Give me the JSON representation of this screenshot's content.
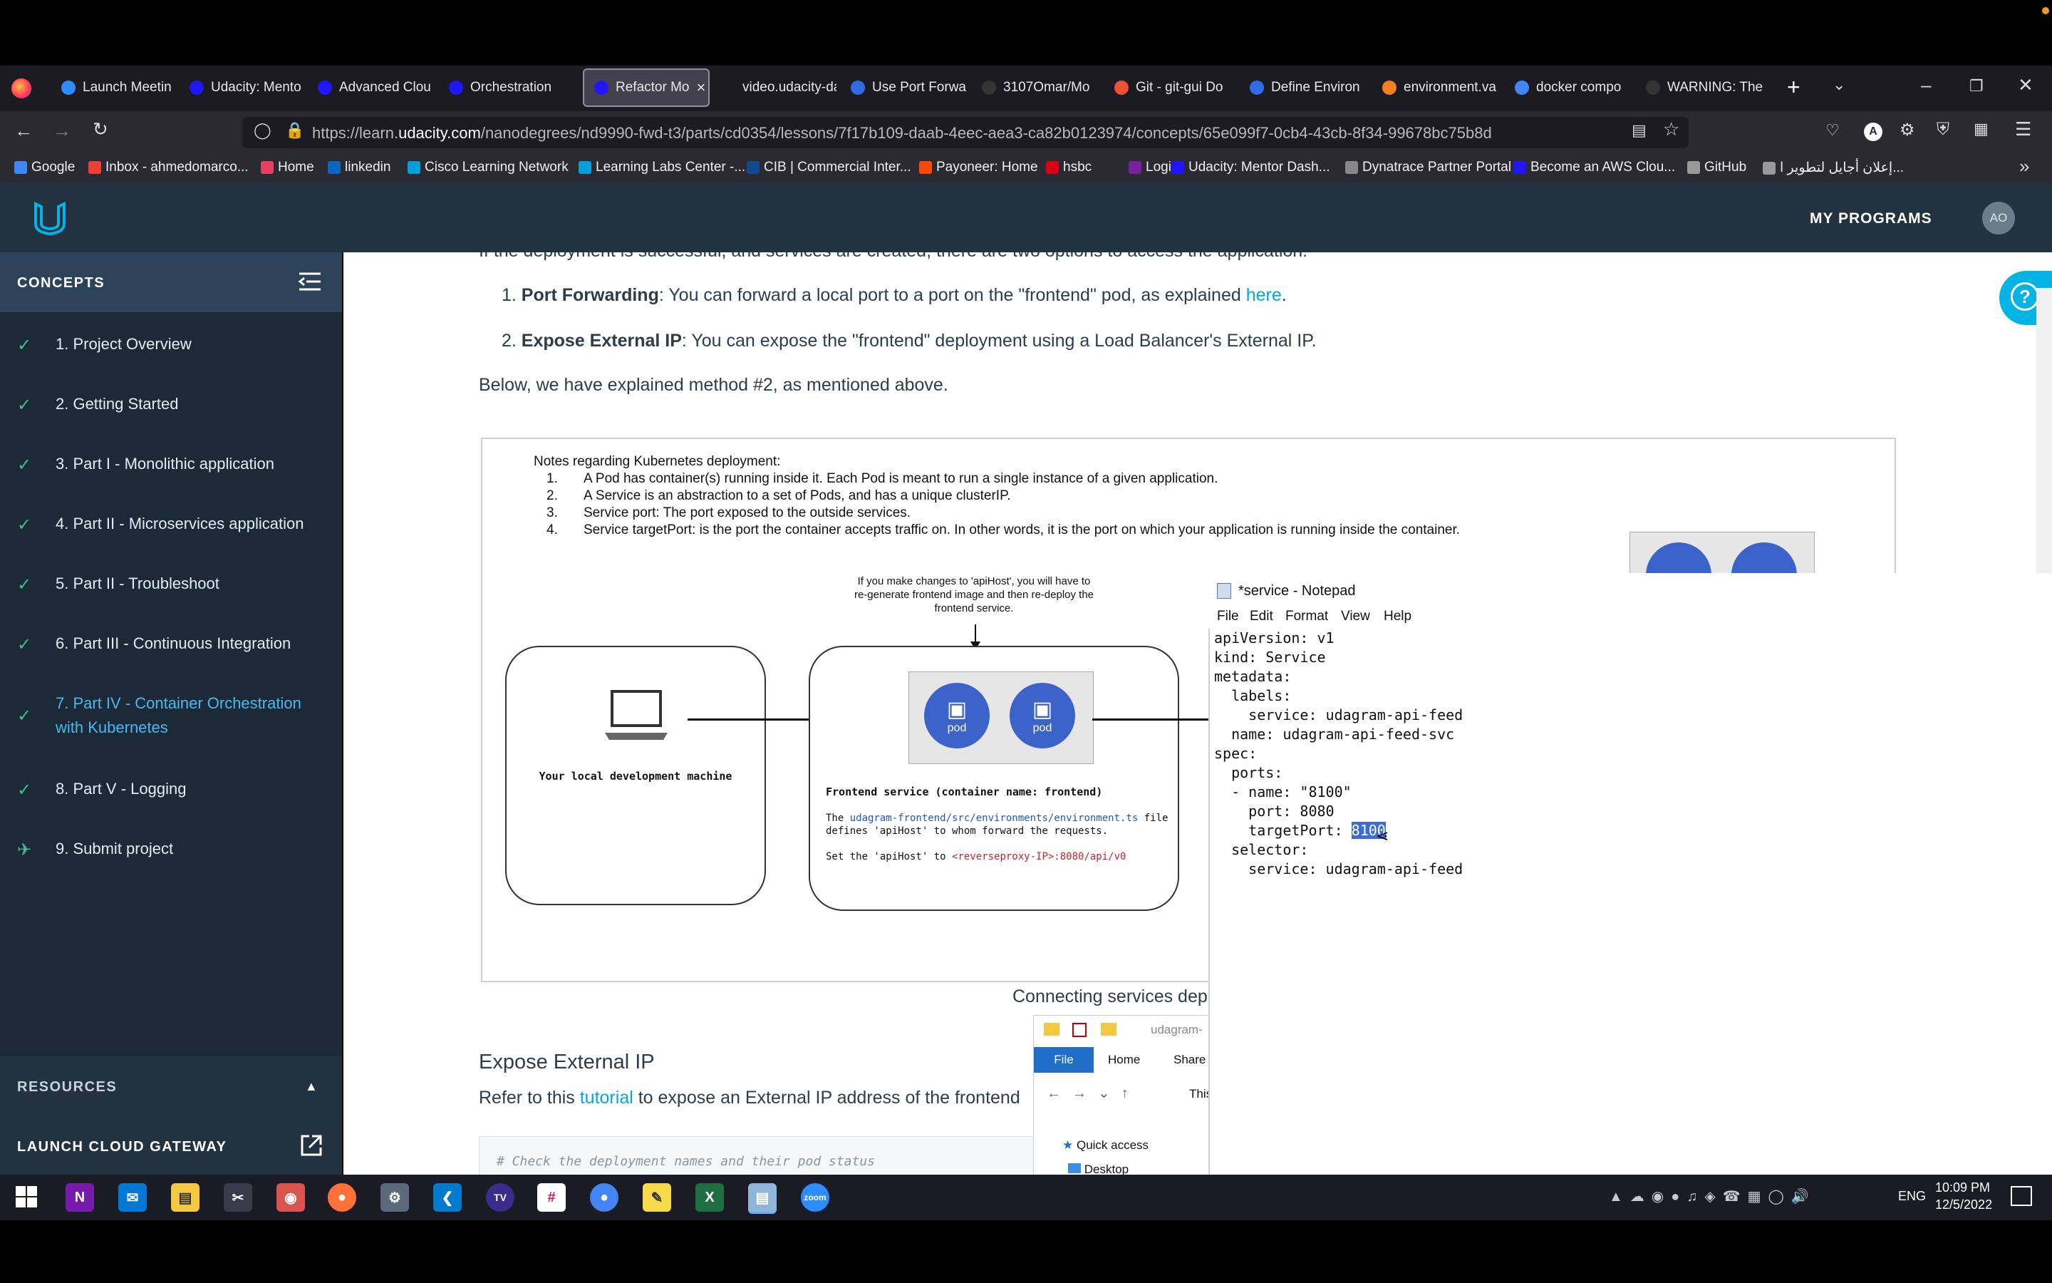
{
  "browser": {
    "tabs": [
      {
        "label": "Launch Meetin",
        "color": "#2d8cff"
      },
      {
        "label": "Udacity: Mento",
        "color": "#2015ff"
      },
      {
        "label": "Advanced Clou",
        "color": "#2015ff"
      },
      {
        "label": "Orchestration",
        "color": "#2015ff"
      },
      {
        "label": "Refactor Mo",
        "color": "#2015ff"
      },
      {
        "label": "video.udacity-data",
        "color": "#1c1b22"
      },
      {
        "label": "Use Port Forwa",
        "color": "#326ce5"
      },
      {
        "label": "3107Omar/Mo",
        "color": "#333333"
      },
      {
        "label": "Git - git-gui Do",
        "color": "#f05133"
      },
      {
        "label": "Define Environ",
        "color": "#326ce5"
      },
      {
        "label": "environment.va",
        "color": "#f48024"
      },
      {
        "label": "docker compo",
        "color": "#4285f4"
      },
      {
        "label": "WARNING: The",
        "color": "#333333"
      }
    ],
    "tab_close": "×",
    "new_tab": "+",
    "url_prefix": "https://learn.",
    "url_domain": "udacity.com",
    "url_rest": "/nanodegrees/nd9990-fwd-t3/parts/cd0354/lessons/7f17b109-daab-4eec-aea3-ca82b0123974/concepts/65e099f7-0cb4-43cb-8f34-99678bc75b8d",
    "bookmarks": [
      {
        "label": "Google",
        "color": "#4285f4"
      },
      {
        "label": "Inbox - ahmedomarco...",
        "color": "#ea4335"
      },
      {
        "label": "Home",
        "color": "#e4405f"
      },
      {
        "label": "linkedin",
        "color": "#0a66c2"
      },
      {
        "label": "Cisco Learning Network",
        "color": "#049fd9"
      },
      {
        "label": "Learning Labs Center -...",
        "color": "#049fd9"
      },
      {
        "label": "CIB | Commercial Inter...",
        "color": "#0d4a8f"
      },
      {
        "label": "Payoneer: Home",
        "color": "#ff4800"
      },
      {
        "label": "hsbc",
        "color": "#db0011"
      },
      {
        "label": "Login",
        "color": "#7a1fa2"
      },
      {
        "label": "Udacity: Mentor Dash...",
        "color": "#2015ff"
      },
      {
        "label": "Dynatrace Partner Portal",
        "color": "#888888"
      },
      {
        "label": "Become an AWS Clou...",
        "color": "#2015ff"
      },
      {
        "label": "GitHub",
        "color": "#999999"
      },
      {
        "label": "إعلان أجايل لتطوير ا...",
        "color": "#999999"
      }
    ]
  },
  "udacity": {
    "my_programs": "MY PROGRAMS",
    "avatar": "AO",
    "concepts_title": "CONCEPTS",
    "concepts": [
      {
        "label": "1. Project Overview"
      },
      {
        "label": "2. Getting Started"
      },
      {
        "label": "3. Part I - Monolithic application"
      },
      {
        "label": "4. Part II - Microservices application"
      },
      {
        "label": "5. Part II - Troubleshoot"
      },
      {
        "label": "6. Part III - Continuous Integration"
      },
      {
        "label": "7. Part IV - Container Orchestration",
        "label2": "with Kubernetes"
      },
      {
        "label": "8. Part V - Logging"
      },
      {
        "label": "9. Submit project"
      }
    ],
    "resources": "RESOURCES",
    "launch_gateway": "LAUNCH CLOUD GATEWAY"
  },
  "content": {
    "top_cut": "If the deployment is successful, and services are created, there are two options to access the application:",
    "opt1_bold": "Port Forwarding",
    "opt1_text": ": You can forward a local port to a port on the \"frontend\" pod, as explained ",
    "opt1_link": "here",
    "opt2_bold": "Expose External IP",
    "opt2_text": ": You can expose the \"frontend\" deployment using a Load Balancer's External IP.",
    "below": "Below, we have explained method #2, as mentioned above.",
    "notes_title": "Notes regarding Kubernetes deployment:",
    "notes": [
      "A Pod has container(s) running inside it. Each Pod is meant to run a single instance of a given application.",
      "A Service is an abstraction to a set of Pods, and has a unique clusterIP.",
      "Service port: The port exposed to the outside services.",
      "Service targetPort: is the port the container accepts traffic on. In other words, it is the port on which your application is running inside the container."
    ],
    "apihost_note_1": "If you make changes to 'apiHost', you will have to",
    "apihost_note_2": "re-generate frontend image and then re-deploy the",
    "apihost_note_3": "frontend service.",
    "local_machine": "Your local development machine",
    "pod_label": "pod",
    "frontend_service": "Frontend service (container name: frontend)",
    "fs_line1a": "The ",
    "fs_line1_link": "udagram-frontend/src/environments/environment.ts",
    "fs_line1b": " file",
    "fs_line2": "defines 'apiHost' to whom forward the requests.",
    "fs_line3a": "Set the 'apiHost' to ",
    "fs_line3b": "<reverseproxy-IP>:8080/api/v0",
    "caption": "Connecting services depl",
    "h_expose": "Expose External IP",
    "refer_a": "Refer to this ",
    "refer_link": "tutorial",
    "refer_b": " to expose an External IP address of the frontend",
    "code_comment": "# Check the deployment names and their pod status"
  },
  "notepad": {
    "title": "*service - Notepad",
    "menu": [
      "File",
      "Edit",
      "Format",
      "View",
      "Help"
    ],
    "lines_before": "apiVersion: v1\nkind: Service\nmetadata:\n  labels:\n    service: udagram-api-feed\n  name: udagram-api-feed-svc\nspec:\n  ports:\n  - name: \"8100\"\n    port: 8080\n    targetPort: ",
    "selected": "8100",
    "lines_after": "\n  selector:\n    service: udagram-api-feed"
  },
  "explorer": {
    "path_hint": "udagram-",
    "tabs": [
      "File",
      "Home",
      "Share"
    ],
    "crumb": "This",
    "quick_access": "Quick access",
    "desktop": "Desktop"
  },
  "taskbar": {
    "lang": "ENG",
    "time": "10:09 PM",
    "date": "12/5/2022"
  }
}
